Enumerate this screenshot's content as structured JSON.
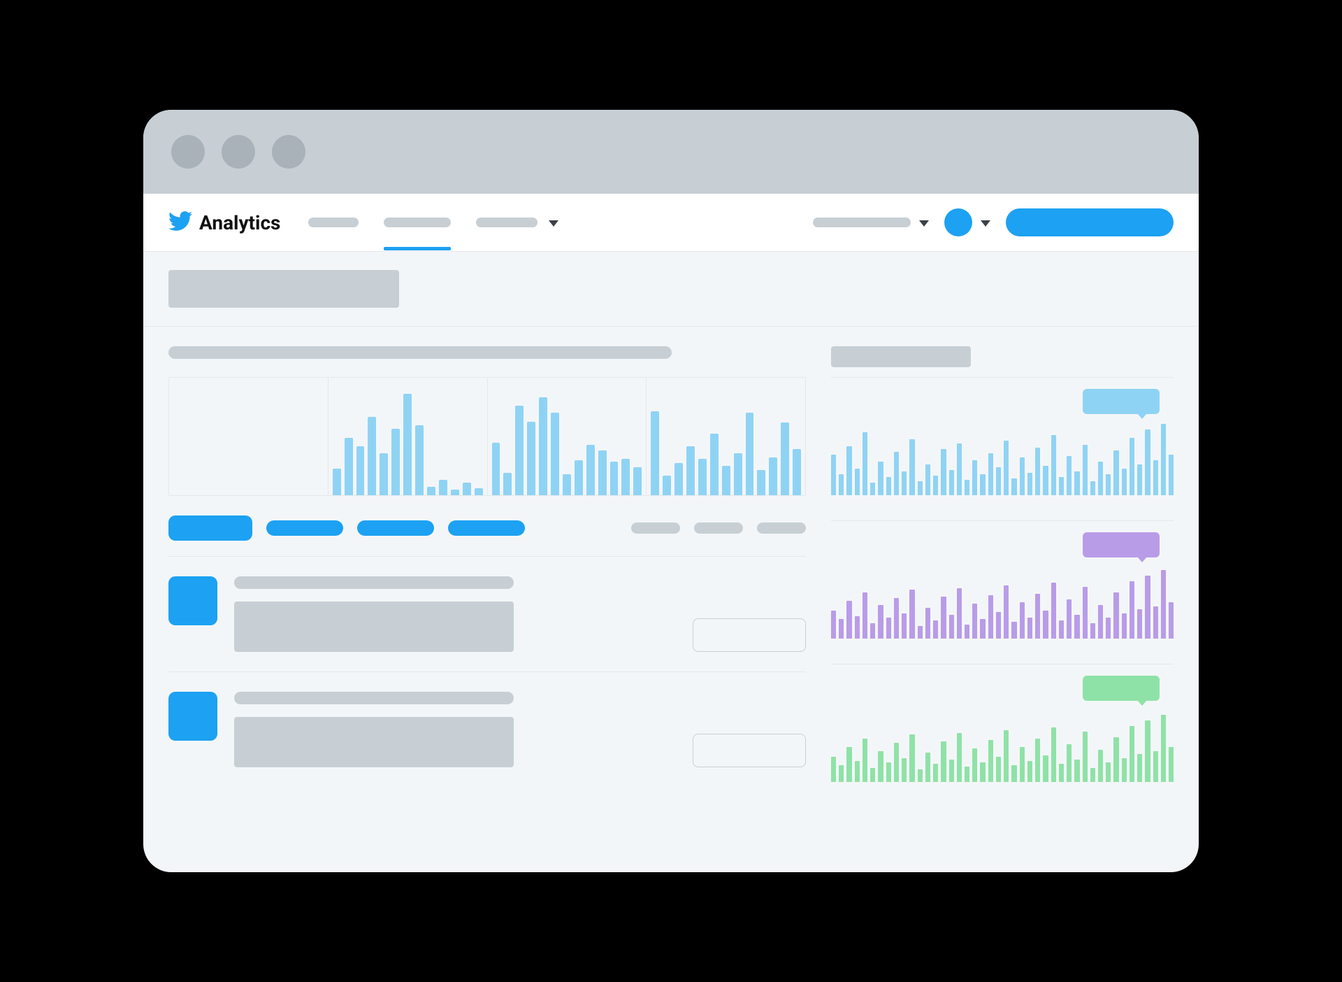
{
  "brand": {
    "name": "Analytics"
  },
  "colors": {
    "primary": "#1DA1F2",
    "chartBlue": "#8FD3F4",
    "miniBlue": "#8FD3F4",
    "miniPurple": "#B99CE8",
    "miniGreen": "#8FE2A7",
    "muted": "#C7CFD4"
  },
  "chart_data": [
    {
      "type": "bar",
      "title": "",
      "series": [
        {
          "name": "panel-1",
          "values": []
        },
        {
          "name": "panel-2",
          "values": [
            38,
            82,
            70,
            112,
            60,
            95,
            145,
            100,
            12,
            22,
            8,
            18,
            10
          ]
        },
        {
          "name": "panel-3",
          "values": [
            75,
            32,
            128,
            105,
            140,
            118,
            30,
            50,
            72,
            64,
            48,
            52,
            40
          ]
        },
        {
          "name": "panel-4",
          "values": [
            120,
            28,
            46,
            70,
            52,
            88,
            42,
            60,
            118,
            36,
            54,
            104,
            66
          ]
        }
      ],
      "ylim": [
        0,
        150
      ]
    },
    {
      "type": "bar",
      "title": "side-blue",
      "values": [
        58,
        30,
        70,
        38,
        90,
        18,
        48,
        26,
        62,
        34,
        80,
        20,
        44,
        28,
        66,
        36,
        74,
        22,
        50,
        30,
        60,
        40,
        78,
        24,
        54,
        32,
        68,
        42,
        86,
        26,
        56,
        34,
        72,
        20,
        48,
        30,
        64,
        38,
        82,
        44,
        94,
        50,
        102,
        58
      ],
      "ylim": [
        0,
        110
      ]
    },
    {
      "type": "bar",
      "title": "side-purple",
      "values": [
        40,
        28,
        54,
        32,
        66,
        22,
        48,
        30,
        58,
        36,
        70,
        18,
        44,
        26,
        60,
        34,
        72,
        20,
        50,
        28,
        62,
        38,
        76,
        24,
        52,
        30,
        64,
        40,
        80,
        26,
        56,
        34,
        74,
        22,
        48,
        30,
        66,
        36,
        82,
        42,
        90,
        46,
        98,
        52
      ],
      "ylim": [
        0,
        110
      ]
    },
    {
      "type": "bar",
      "title": "side-green",
      "values": [
        36,
        24,
        50,
        30,
        62,
        20,
        44,
        28,
        56,
        34,
        68,
        18,
        42,
        26,
        58,
        32,
        70,
        22,
        48,
        28,
        60,
        36,
        74,
        24,
        50,
        30,
        62,
        38,
        78,
        26,
        54,
        32,
        72,
        20,
        46,
        28,
        64,
        34,
        80,
        40,
        88,
        44,
        96,
        50
      ],
      "ylim": [
        0,
        110
      ]
    }
  ]
}
